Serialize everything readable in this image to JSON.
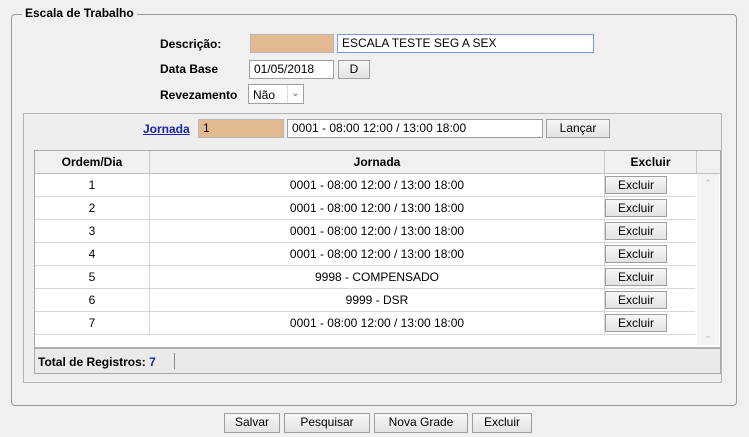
{
  "fieldset": {
    "title": "Escala de Trabalho",
    "descricao_label": "Descrição:",
    "descricao_code": "",
    "descricao_text": "ESCALA TESTE SEG A SEX",
    "database_label": "Data Base",
    "database_value": "01/05/2018",
    "database_button": "D",
    "revezamento_label": "Revezamento",
    "revezamento_value": "Não"
  },
  "jornada_bar": {
    "link": "Jornada",
    "code": "1",
    "description": "0001 - 08:00 12:00 / 13:00 18:00",
    "launch_button": "Lançar"
  },
  "grid": {
    "headers": [
      "Ordem/Dia",
      "Jornada",
      "Excluir"
    ],
    "rows": [
      {
        "ordem": "1",
        "jornada": "0001 - 08:00 12:00 / 13:00 18:00",
        "action": "Excluir"
      },
      {
        "ordem": "2",
        "jornada": "0001 - 08:00 12:00 / 13:00 18:00",
        "action": "Excluir"
      },
      {
        "ordem": "3",
        "jornada": "0001 - 08:00 12:00 / 13:00 18:00",
        "action": "Excluir"
      },
      {
        "ordem": "4",
        "jornada": "0001 - 08:00 12:00 / 13:00 18:00",
        "action": "Excluir"
      },
      {
        "ordem": "5",
        "jornada": "9998 - COMPENSADO",
        "action": "Excluir"
      },
      {
        "ordem": "6",
        "jornada": "9999 - DSR",
        "action": "Excluir"
      },
      {
        "ordem": "7",
        "jornada": "0001 - 08:00 12:00 / 13:00 18:00",
        "action": "Excluir"
      }
    ],
    "footer_label": "Total de Registros:",
    "footer_count": "7"
  },
  "bottom_buttons": {
    "salvar": "Salvar",
    "pesquisar": "Pesquisar",
    "nova_grade": "Nova Grade",
    "excluir": "Excluir"
  },
  "colors": {
    "accent_field": "#e3b98f",
    "link": "#1a22a8"
  }
}
